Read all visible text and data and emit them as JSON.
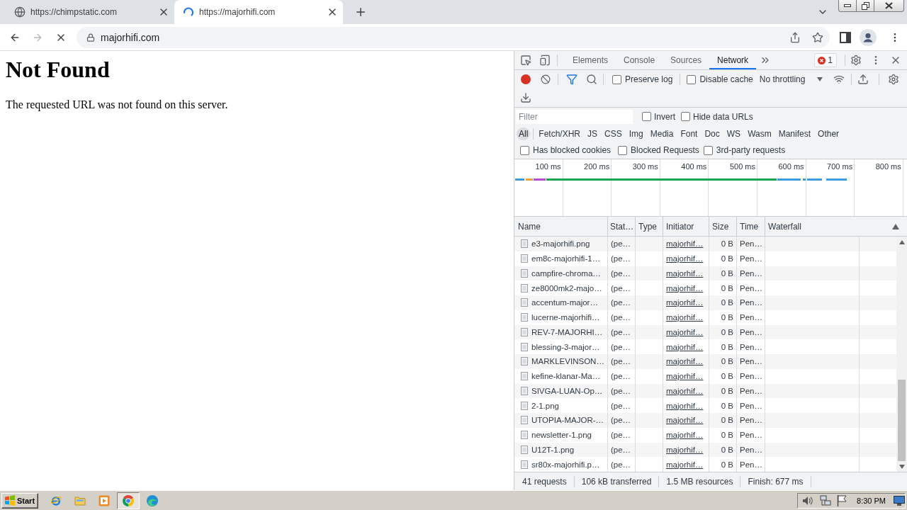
{
  "browser": {
    "tabs": [
      {
        "title": "https://chimpstatic.com",
        "selected": false,
        "loading": false
      },
      {
        "title": "https://majorhifi.com",
        "selected": true,
        "loading": true
      }
    ],
    "forward_enabled": false,
    "address": "majorhifi.com"
  },
  "page": {
    "heading": "Not Found",
    "text": "The requested URL was not found on this server."
  },
  "devtools": {
    "panels": [
      {
        "label": "Elements",
        "selected": false
      },
      {
        "label": "Console",
        "selected": false
      },
      {
        "label": "Sources",
        "selected": false
      },
      {
        "label": "Network",
        "selected": true
      }
    ],
    "error_count": "1",
    "recording": true,
    "options": [
      {
        "label": "Preserve log",
        "checked": false
      },
      {
        "label": "Disable cache",
        "checked": false
      }
    ],
    "throttling": "No throttling",
    "filter": {
      "placeholder": "Filter"
    },
    "filter_options": [
      {
        "label": "Invert",
        "checked": false
      },
      {
        "label": "Hide data URLs",
        "checked": false
      }
    ],
    "types": [
      {
        "label": "All",
        "selected": true
      },
      {
        "label": "Fetch/XHR",
        "selected": false
      },
      {
        "label": "JS",
        "selected": false
      },
      {
        "label": "CSS",
        "selected": false
      },
      {
        "label": "Img",
        "selected": false
      },
      {
        "label": "Media",
        "selected": false
      },
      {
        "label": "Font",
        "selected": false
      },
      {
        "label": "Doc",
        "selected": false
      },
      {
        "label": "WS",
        "selected": false
      },
      {
        "label": "Wasm",
        "selected": false
      },
      {
        "label": "Manifest",
        "selected": false
      },
      {
        "label": "Other",
        "selected": false
      }
    ],
    "request_filters": [
      {
        "label": "Has blocked cookies",
        "checked": false
      },
      {
        "label": "Blocked Requests",
        "checked": false
      },
      {
        "label": "3rd-party requests",
        "checked": false
      }
    ],
    "overview": {
      "ticks": [
        "100 ms",
        "200 ms",
        "300 ms",
        "400 ms",
        "500 ms",
        "600 ms",
        "700 ms",
        "800 ms"
      ]
    },
    "table": {
      "columns": [
        "Name",
        "Stat…",
        "Type",
        "Initiator",
        "Size",
        "Time",
        "Waterfall"
      ],
      "rows": [
        {
          "name": "e3-majorhifi.png",
          "status": "(pe…",
          "initiator": "majorhif…",
          "size": "0 B",
          "time": "Pen…"
        },
        {
          "name": "em8c-majorhifi-1…",
          "status": "(pe…",
          "initiator": "majorhif…",
          "size": "0 B",
          "time": "Pen…"
        },
        {
          "name": "campfire-chroma…",
          "status": "(pe…",
          "initiator": "majorhif…",
          "size": "0 B",
          "time": "Pen…"
        },
        {
          "name": "ze8000mk2-majo…",
          "status": "(pe…",
          "initiator": "majorhif…",
          "size": "0 B",
          "time": "Pen…"
        },
        {
          "name": "accentum-major…",
          "status": "(pe…",
          "initiator": "majorhif…",
          "size": "0 B",
          "time": "Pen…"
        },
        {
          "name": "lucerne-majorhifi…",
          "status": "(pe…",
          "initiator": "majorhif…",
          "size": "0 B",
          "time": "Pen…"
        },
        {
          "name": "REV-7-MAJORHI…",
          "status": "(pe…",
          "initiator": "majorhif…",
          "size": "0 B",
          "time": "Pen…"
        },
        {
          "name": "blessing-3-major…",
          "status": "(pe…",
          "initiator": "majorhif…",
          "size": "0 B",
          "time": "Pen…"
        },
        {
          "name": "MARKLEVINSON…",
          "status": "(pe…",
          "initiator": "majorhif…",
          "size": "0 B",
          "time": "Pen…"
        },
        {
          "name": "kefine-klanar-Ma…",
          "status": "(pe…",
          "initiator": "majorhif…",
          "size": "0 B",
          "time": "Pen…"
        },
        {
          "name": "SIVGA-LUAN-Op…",
          "status": "(pe…",
          "initiator": "majorhif…",
          "size": "0 B",
          "time": "Pen…"
        },
        {
          "name": "2-1.png",
          "status": "(pe…",
          "initiator": "majorhif…",
          "size": "0 B",
          "time": "Pen…"
        },
        {
          "name": "UTOPIA-MAJOR-…",
          "status": "(pe…",
          "initiator": "majorhif…",
          "size": "0 B",
          "time": "Pen…"
        },
        {
          "name": "newsletter-1.png",
          "status": "(pe…",
          "initiator": "majorhif…",
          "size": "0 B",
          "time": "Pen…"
        },
        {
          "name": "U12T-1.png",
          "status": "(pe…",
          "initiator": "majorhif…",
          "size": "0 B",
          "time": "Pen…"
        },
        {
          "name": "sr80x-majorhifi.p…",
          "status": "(pe…",
          "initiator": "majorhif…",
          "size": "0 B",
          "time": "Pen…"
        }
      ]
    },
    "status_bar": [
      "41 requests",
      "106 kB transferred",
      "1.5 MB resources",
      "Finish: 677 ms"
    ]
  },
  "taskbar": {
    "start": "Start",
    "apps": [
      {
        "kind": "ie",
        "selected": false
      },
      {
        "kind": "explorer",
        "selected": false
      },
      {
        "kind": "player",
        "selected": false
      },
      {
        "kind": "chrome",
        "selected": true
      },
      {
        "kind": "edge",
        "selected": false
      }
    ],
    "clock": "8:30 PM"
  }
}
